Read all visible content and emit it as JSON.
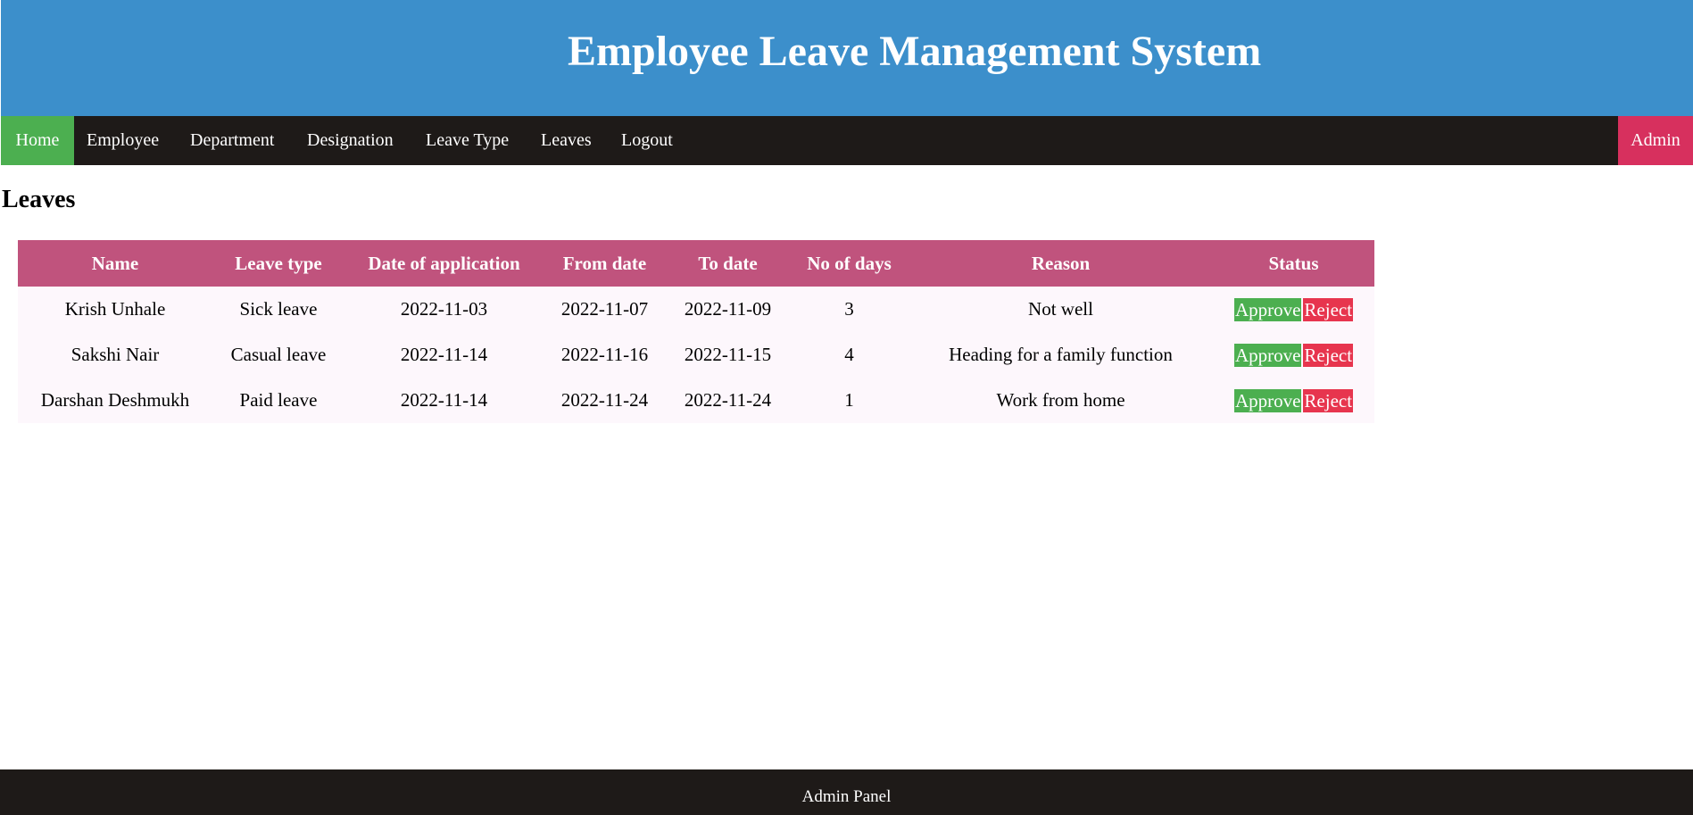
{
  "header": {
    "title": "Employee Leave Management System"
  },
  "nav": {
    "items": [
      {
        "label": "Home"
      },
      {
        "label": "Employee"
      },
      {
        "label": "Department"
      },
      {
        "label": "Designation"
      },
      {
        "label": "Leave Type"
      },
      {
        "label": "Leaves"
      },
      {
        "label": "Logout"
      }
    ],
    "admin": "Admin"
  },
  "page": {
    "title": "Leaves"
  },
  "table": {
    "columns": [
      "Name",
      "Leave type",
      "Date of application",
      "From date",
      "To date",
      "No of days",
      "Reason",
      "Status"
    ],
    "rows": [
      {
        "name": "Krish Unhale",
        "leave_type": "Sick leave",
        "applied": "2022-11-03",
        "from": "2022-11-07",
        "to": "2022-11-09",
        "days": "3",
        "reason": "Not well",
        "approve": "Approve",
        "reject": "Reject"
      },
      {
        "name": "Sakshi Nair",
        "leave_type": "Casual leave",
        "applied": "2022-11-14",
        "from": "2022-11-16",
        "to": "2022-11-15",
        "days": "4",
        "reason": "Heading for a family function",
        "approve": "Approve",
        "reject": "Reject"
      },
      {
        "name": "Darshan Deshmukh",
        "leave_type": "Paid leave",
        "applied": "2022-11-14",
        "from": "2022-11-24",
        "to": "2022-11-24",
        "days": "1",
        "reason": "Work from home",
        "approve": "Approve",
        "reject": "Reject"
      }
    ]
  },
  "footer": {
    "text": "Admin Panel"
  },
  "colors": {
    "header_bg": "#3c8fcb",
    "nav_bg": "#1e1a18",
    "home_active": "#4caf50",
    "admin_bg": "#d7305e",
    "table_header": "#c0537d",
    "row_bg": "#fdf7fc",
    "approve": "#4caf50",
    "reject": "#e7354e"
  }
}
